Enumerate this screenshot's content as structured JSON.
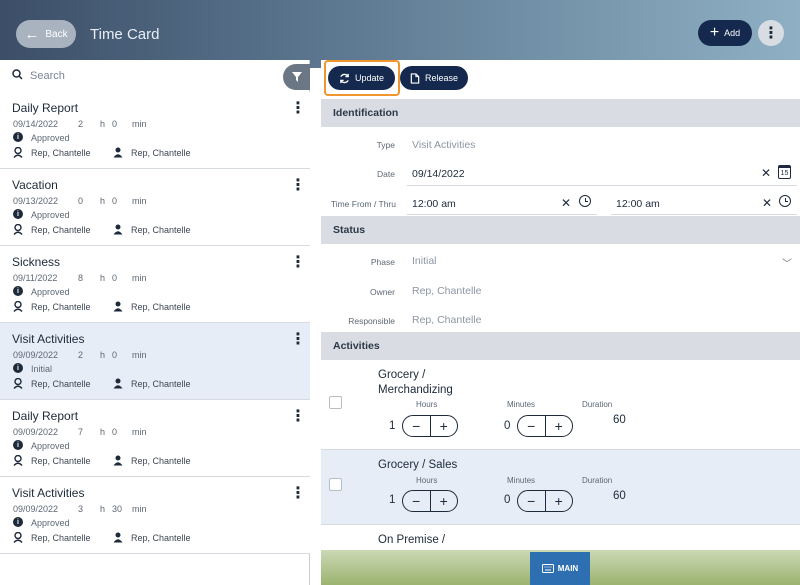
{
  "header": {
    "back_label": "Back",
    "title": "Time Card",
    "add_label": "Add"
  },
  "search": {
    "placeholder": "Search"
  },
  "list": [
    {
      "name": "Daily Report",
      "date": "09/14/2022",
      "hours": "2",
      "minutes": "0",
      "status": "Approved",
      "owner": "Rep, Chantelle",
      "responsible": "Rep, Chantelle"
    },
    {
      "name": "Vacation",
      "date": "09/13/2022",
      "hours": "0",
      "minutes": "0",
      "status": "Approved",
      "owner": "Rep, Chantelle",
      "responsible": "Rep, Chantelle"
    },
    {
      "name": "Sickness",
      "date": "09/11/2022",
      "hours": "8",
      "minutes": "0",
      "status": "Approved",
      "owner": "Rep, Chantelle",
      "responsible": "Rep, Chantelle"
    },
    {
      "name": "Visit Activities",
      "date": "09/09/2022",
      "hours": "2",
      "minutes": "0",
      "status": "Initial",
      "owner": "Rep, Chantelle",
      "responsible": "Rep, Chantelle"
    },
    {
      "name": "Daily Report",
      "date": "09/09/2022",
      "hours": "7",
      "minutes": "0",
      "status": "Approved",
      "owner": "Rep, Chantelle",
      "responsible": "Rep, Chantelle"
    },
    {
      "name": "Visit Activities",
      "date": "09/09/2022",
      "hours": "3",
      "minutes": "30",
      "status": "Approved",
      "owner": "Rep, Chantelle",
      "responsible": "Rep, Chantelle"
    }
  ],
  "units": {
    "h": "h",
    "min": "min"
  },
  "toolbar": {
    "update_label": "Update",
    "release_label": "Release"
  },
  "identification": {
    "header": "Identification",
    "type_label": "Type",
    "type_value": "Visit Activities",
    "date_label": "Date",
    "date_value": "09/14/2022",
    "time_label": "Time From / Thru",
    "time_from": "12:00 am",
    "time_thru": "12:00 am"
  },
  "status": {
    "header": "Status",
    "phase_label": "Phase",
    "phase_value": "Initial",
    "owner_label": "Owner",
    "owner_value": "Rep, Chantelle",
    "responsible_label": "Responsible",
    "responsible_value": "Rep, Chantelle"
  },
  "activities": {
    "header": "Activities",
    "hours_label": "Hours",
    "minutes_label": "Minutes",
    "duration_label": "Duration",
    "items": [
      {
        "name_line1": "Grocery /",
        "name_line2": "Merchandizing",
        "hours": "1",
        "minutes": "0",
        "duration": "60"
      },
      {
        "name_line1": "Grocery / Sales",
        "name_line2": "",
        "hours": "1",
        "minutes": "0",
        "duration": "60"
      },
      {
        "name_line1": "On Premise /",
        "name_line2": ""
      }
    ]
  },
  "bottom": {
    "main_label": "MAIN"
  },
  "colors": {
    "accent": "#14294d",
    "highlight": "#f0962e",
    "selected_row": "#e6edf7"
  }
}
